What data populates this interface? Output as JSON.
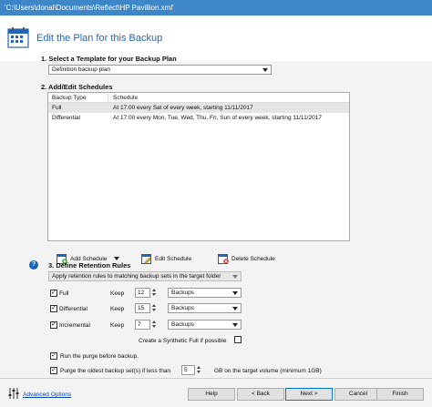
{
  "window": {
    "title": "'C:\\Users\\donal\\Documents\\Reflect\\HP Pavillion.xml'"
  },
  "header": {
    "title": "Edit the Plan for this Backup"
  },
  "section1": {
    "label": "1. Select a Template for your Backup Plan",
    "template_value": "Definition backup plan"
  },
  "section2": {
    "label": "2. Add/Edit Schedules",
    "columns": [
      "Backup Type",
      "Schedule"
    ],
    "rows": [
      {
        "type": "Full",
        "schedule": "At 17:00 every Sat of every week, starting 11/11/2017"
      },
      {
        "type": "Differential",
        "schedule": "At 17:00 every Mon, Tue, Wed, Thu, Fri, Sun of every week, starting 11/11/2017"
      }
    ],
    "add_schedule": "Add Schedule",
    "edit_schedule": "Edit Schedule",
    "delete_schedule": "Delete Schedule"
  },
  "section3": {
    "label": "3. Define Retention Rules",
    "rule_value": "Apply retention rules to matching backup sets in the target folder",
    "keep_label": "Keep",
    "rules": [
      {
        "name": "Full",
        "checked": true,
        "keep": "12",
        "unit": "Backups"
      },
      {
        "name": "Differential",
        "checked": true,
        "keep": "15",
        "unit": "Backups"
      },
      {
        "name": "Incremental",
        "checked": true,
        "keep": "7",
        "unit": "Backups"
      }
    ],
    "synthetic_label": "Create a Synthetic Full if possible",
    "synthetic_checked": false
  },
  "purge": {
    "run_before_label": "Run the purge before backup.",
    "run_before_checked": true,
    "oldest_label": "Purge the oldest backup set(s) if less than",
    "oldest_checked": true,
    "oldest_value": "5",
    "oldest_suffix": "GB on the target volume (minimum 1GB)"
  },
  "footer": {
    "advanced_options": "Advanced Options",
    "help": "Help",
    "back": "< Back",
    "next": "Next >",
    "cancel": "Cancel",
    "finish": "Finish"
  },
  "colors": {
    "titlebar": "#3d87c9",
    "header_title": "#2466b6",
    "link": "#0645ad",
    "help_icon": "#1c64b4"
  },
  "icons": [
    "calendar-icon",
    "add-schedule-icon",
    "edit-schedule-icon",
    "delete-schedule-icon",
    "help-icon",
    "advanced-options-icon"
  ]
}
